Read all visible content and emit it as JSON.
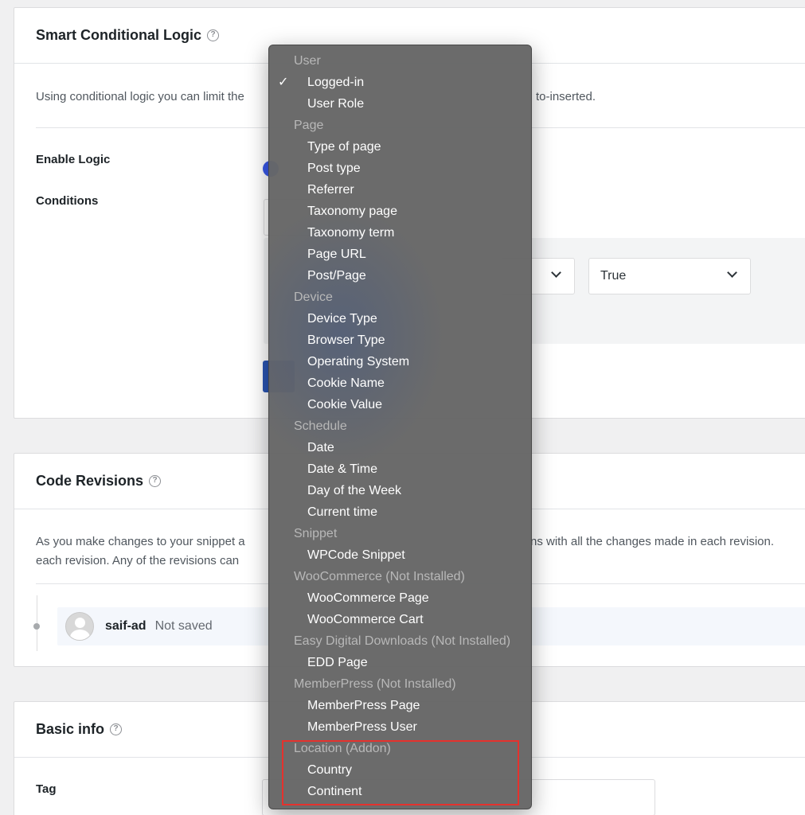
{
  "smart_logic": {
    "title": "Smart Conditional Logic",
    "help_icon": "question-circle-icon",
    "description_left": "Using conditional logic you can limit the",
    "description_right": "to-inserted.",
    "enable_label": "Enable Logic",
    "conditions_label": "Conditions",
    "value_select": "True"
  },
  "revisions": {
    "title": "Code Revisions",
    "help_icon": "question-circle-icon",
    "description_line1_left": "As you make changes to your snippet a",
    "description_line1_right": "ns with all the changes made in each revision.",
    "description_line2_left": "each revision. Any of the revisions can",
    "user": "saif-ad",
    "status": "Not saved"
  },
  "basic_info": {
    "title": "Basic info",
    "help_icon": "question-circle-icon",
    "tag_label": "Tag"
  },
  "dropdown": {
    "selected": "Logged-in",
    "groups": [
      {
        "label": "User",
        "items": [
          "Logged-in",
          "User Role"
        ]
      },
      {
        "label": "Page",
        "items": [
          "Type of page",
          "Post type",
          "Referrer",
          "Taxonomy page",
          "Taxonomy term",
          "Page URL",
          "Post/Page"
        ]
      },
      {
        "label": "Device",
        "items": [
          "Device Type",
          "Browser Type",
          "Operating System",
          "Cookie Name",
          "Cookie Value"
        ]
      },
      {
        "label": "Schedule",
        "items": [
          "Date",
          "Date & Time",
          "Day of the Week",
          "Current time"
        ]
      },
      {
        "label": "Snippet",
        "items": [
          "WPCode Snippet"
        ]
      },
      {
        "label": "WooCommerce (Not Installed)",
        "items": [
          "WooCommerce Page",
          "WooCommerce Cart"
        ]
      },
      {
        "label": "Easy Digital Downloads (Not Installed)",
        "items": [
          "EDD Page"
        ]
      },
      {
        "label": "MemberPress (Not Installed)",
        "items": [
          "MemberPress Page",
          "MemberPress User"
        ]
      },
      {
        "label": "Location (Addon)",
        "items": [
          "Country",
          "Continent"
        ]
      }
    ],
    "highlight_color": "#e5322d"
  }
}
